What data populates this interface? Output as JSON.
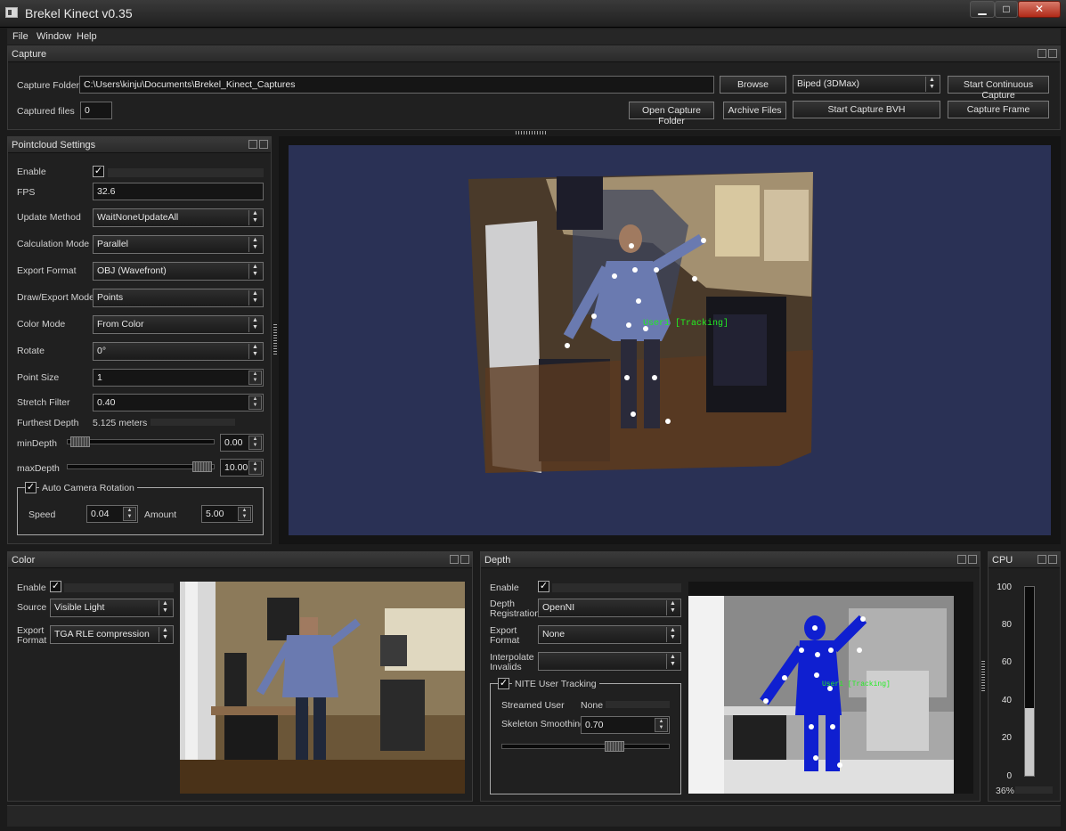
{
  "window": {
    "title": "Brekel Kinect v0.35",
    "minimize": "▁",
    "maximize": "□",
    "close": "✕"
  },
  "menu": [
    "File",
    "Window",
    "Help"
  ],
  "capture": {
    "title": "Capture",
    "folder_label": "Capture Folder",
    "folder_value": "C:\\Users\\kinju\\Documents\\Brekel_Kinect_Captures",
    "browse": "Browse",
    "format_value": "Biped (3DMax)",
    "start_continuous": "Start Continuous Capture",
    "files_label": "Captured files",
    "files_value": "0",
    "open_folder": "Open Capture Folder",
    "archive": "Archive Files",
    "start_bvh": "Start Capture BVH",
    "capture_frame": "Capture Frame"
  },
  "pointcloud": {
    "title": "Pointcloud Settings",
    "enable_label": "Enable",
    "enable_checked": "✓",
    "fps_label": "FPS",
    "fps_value": "32.6",
    "update_label": "Update Method",
    "update_value": "WaitNoneUpdateAll",
    "calc_label": "Calculation Mode",
    "calc_value": "Parallel",
    "export_label": "Export Format",
    "export_value": "OBJ (Wavefront)",
    "draw_label": "Draw/Export Mode",
    "draw_value": "Points",
    "color_label": "Color Mode",
    "color_value": "From Color",
    "rotate_label": "Rotate",
    "rotate_value": "0°",
    "point_label": "Point Size",
    "point_value": "1",
    "stretch_label": "Stretch Filter",
    "stretch_value": "0.40",
    "furthest_label": "Furthest Depth",
    "furthest_value": "5.125 meters",
    "mindepth_label": "minDepth",
    "mindepth_value": "0.00",
    "maxdepth_label": "maxDepth",
    "maxdepth_value": "10.00",
    "auto_label": "Auto Camera Rotation",
    "speed_label": "Speed",
    "speed_value": "0.04",
    "amount_label": "Amount",
    "amount_value": "5.00"
  },
  "viewport": {
    "user_label": "User1 [Tracking]",
    "accent": "#2a3155"
  },
  "color_panel": {
    "title": "Color",
    "enable_label": "Enable",
    "source_label": "Source",
    "source_value": "Visible Light",
    "export_label": "Export Format",
    "export_value": "TGA  RLE compression"
  },
  "depth_panel": {
    "title": "Depth",
    "enable_label": "Enable",
    "registration_label": "Depth Registration",
    "registration_value": "OpenNI",
    "export_label": "Export Format",
    "export_value": "None",
    "interp_label": "Interpolate Invalids",
    "interp_value": "",
    "nite_label": "NITE User Tracking",
    "streamed_label": "Streamed User",
    "streamed_value": "None",
    "smooth_label": "Skeleton Smoothing",
    "smooth_value": "0.70",
    "user_label": "User1 [Tracking]"
  },
  "cpu": {
    "title": "CPU",
    "ticks": [
      "100",
      "80",
      "60",
      "40",
      "20",
      "0"
    ],
    "percent_text": "36%",
    "level": 0.36
  },
  "icons": [
    "app-icon",
    "float-icon",
    "close-icon",
    "check-icon",
    "spin-arrows-icon",
    "combo-arrow-icon"
  ]
}
